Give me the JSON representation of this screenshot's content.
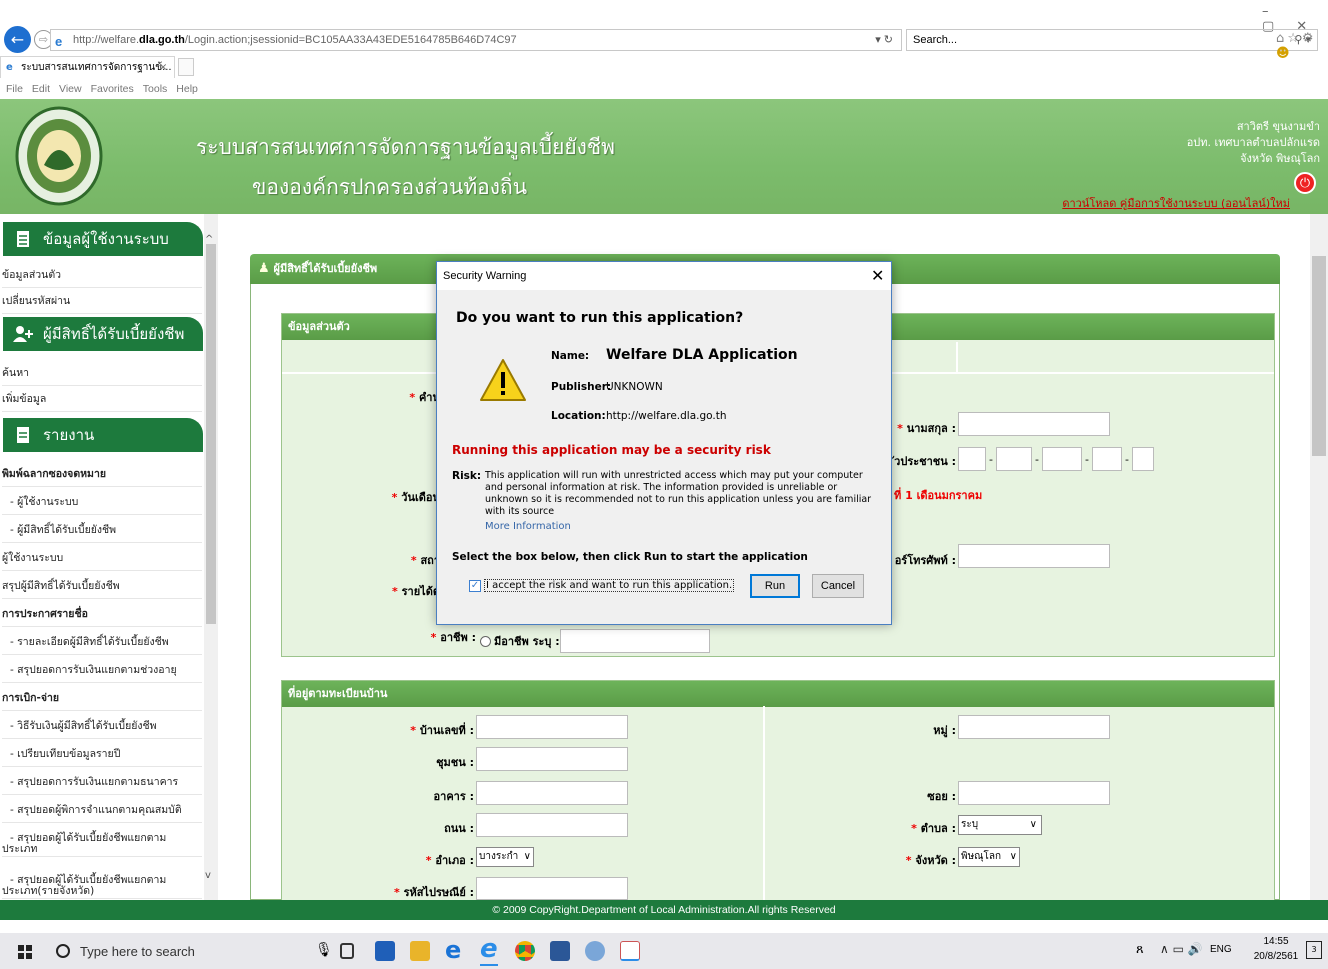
{
  "browser": {
    "url_prefix": "http://welfare.",
    "url_domain": "dla.go.th",
    "url_path": "/Login.action;jsessionid=BC105AA33A43EDE5164785B646D74C97",
    "search_placeholder": "Search...",
    "tab_title": "ระบบสารสนเทศการจัดการฐานข้...",
    "menu": [
      "File",
      "Edit",
      "View",
      "Favorites",
      "Tools",
      "Help"
    ]
  },
  "header": {
    "title_line1": "ระบบสารสนเทศการจัดการฐานข้อมูลเบี้ยยังชีพ",
    "title_line2": "ขององค์กรปกครองส่วนท้องถิ่น",
    "user_name": "สาวิตรี ขุนงามขำ",
    "user_org": "อปท. เทศบาลตำบลปลักแรด",
    "user_province": "จังหวัด พิษณุโลก",
    "download_link": "ดาวน์โหลด คู่มือการใช้งานระบบ (ออนไลน์)ใหม่"
  },
  "sidebar": {
    "group_user": "ข้อมูลผู้ใช้งานระบบ",
    "user_items": [
      "ข้อมูลส่วนตัว",
      "เปลี่ยนรหัสผ่าน"
    ],
    "group_beneficiary": "ผู้มีสิทธิ์ได้รับเบี้ยยังชีพ",
    "beneficiary_items": [
      "ค้นหา",
      "เพิ่มข้อมูล"
    ],
    "group_report": "รายงาน",
    "report_items": [
      {
        "label": "พิมพ์ฉลากซองจดหมาย",
        "bold": true
      },
      {
        "label": "- ผู้ใช้งานระบบ",
        "bold": false
      },
      {
        "label": "- ผู้มีสิทธิ์ได้รับเบี้ยยังชีพ",
        "bold": false
      },
      {
        "label": "ผู้ใช้งานระบบ",
        "bold": false
      },
      {
        "label": "สรุปผู้มีสิทธิ์ได้รับเบี้ยยังชีพ",
        "bold": false
      },
      {
        "label": "การประกาศรายชื่อ",
        "bold": true
      },
      {
        "label": "- รายละเอียดผู้มีสิทธิ์ได้รับเบี้ยยังชีพ",
        "bold": false
      },
      {
        "label": "- สรุปยอดการรับเงินแยกตามช่วงอายุ",
        "bold": false
      },
      {
        "label": "การเบิก-จ่าย",
        "bold": true
      },
      {
        "label": "- วิธีรับเงินผู้มีสิทธิ์ได้รับเบี้ยยังชีพ",
        "bold": false
      },
      {
        "label": "- เปรียบเทียบข้อมูลรายปี",
        "bold": false
      },
      {
        "label": "- สรุปยอดการรับเงินแยกตามธนาคาร",
        "bold": false
      },
      {
        "label": "- สรุปยอดผู้พิการจำแนกตามคุณสมบัติ",
        "bold": false
      },
      {
        "label": "- สรุปยอดผู้ได้รับเบี้ยยังชีพแยกตาม",
        "bold": false
      },
      {
        "label": "ประเภท",
        "bold": false
      },
      {
        "label": "- สรุปยอดผู้ได้รับเบี้ยยังชีพแยกตาม",
        "bold": false
      },
      {
        "label": "ประเภท(รายจังหวัด)",
        "bold": false
      }
    ]
  },
  "main": {
    "section_title": "ผู้มีสิทธิ์ได้รับเบี้ยยังชีพ",
    "personal_title": "ข้อมูลส่วนตัว",
    "label_prefix_partial": "คำน",
    "label_lastname": "นามสกุล :",
    "label_idcard_partial": "ัวประชาชน :",
    "label_birth_partial": "วันเดือน",
    "birth_note_partial": "ที่ 1 เดือนมกราคม",
    "label_status_partial": "สถา",
    "label_phone_partial": "อร์โทรศัพท์ :",
    "label_income_partial": "รายได้ต่",
    "label_job": "อาชีพ :",
    "job_other": "มีอาชีพ  ระบุ :",
    "address_title": "ที่อยู่ตามทะเบียนบ้าน",
    "label_house_no": "บ้านเลขที่ :",
    "label_moo": "หมู่ :",
    "label_community": "ชุมชน :",
    "label_building": "อาคาร :",
    "label_soi": "ซอย :",
    "label_road": "ถนน :",
    "label_tambon": "ตำบล :",
    "tambon_value": "ระบุ",
    "label_amphoe": "อำเภอ :",
    "amphoe_value": "บางระกำ",
    "label_province": "จังหวัด :",
    "province_value": "พิษณุโลก",
    "label_postcode": "รหัสไปรษณีย์ :"
  },
  "dialog": {
    "title": "Security Warning",
    "question": "Do you want to run this application?",
    "name_label": "Name:",
    "name_value": "Welfare DLA Application",
    "publisher_label": "Publisher:",
    "publisher_value": "UNKNOWN",
    "location_label": "Location:",
    "location_value": "http://welfare.dla.go.th",
    "risk_heading": "Running this application may be a security risk",
    "risk_label": "Risk:",
    "risk_text": "This application will run with unrestricted access which may put your computer and personal information at risk. The information provided is unreliable or unknown so it is recommended not to run this application unless you are familiar with its source",
    "more_info": "More Information",
    "instruction": "Select the box below, then click Run to start the application",
    "checkbox_label": "I accept the risk and want to run this application.",
    "checkbox_checked": true,
    "run_label": "Run",
    "cancel_label": "Cancel"
  },
  "footer": {
    "text": "© 2009 CopyRight.Department of Local Administration.All rights Reserved"
  },
  "taskbar": {
    "search_placeholder": "Type here to search",
    "lang": "ENG",
    "time": "14:55",
    "date": "20/8/2561",
    "notif_count": "3"
  }
}
